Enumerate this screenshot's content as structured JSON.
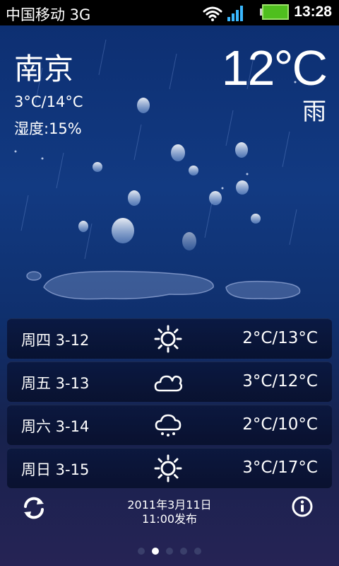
{
  "status_bar": {
    "carrier": "中国移动 3G",
    "time": "13:28",
    "icons": [
      "wifi-icon",
      "signal-icon",
      "battery-icon"
    ]
  },
  "weather": {
    "city": "南京",
    "temp_range": "3°C/14°C",
    "humidity": "湿度:15%",
    "current_temp": "12°C",
    "condition": "雨"
  },
  "forecast": [
    {
      "day": "周四 3-12",
      "icon": "sun-icon",
      "temp": "2°C/13°C"
    },
    {
      "day": "周五 3-13",
      "icon": "cloud-icon",
      "temp": "3°C/12°C"
    },
    {
      "day": "周六 3-14",
      "icon": "rain-cloud-icon",
      "temp": "2°C/10°C"
    },
    {
      "day": "周日 3-15",
      "icon": "sun-icon",
      "temp": "3°C/17°C"
    }
  ],
  "footer": {
    "publish_date": "2011年3月11日",
    "publish_time": "11:00发布"
  },
  "pager": {
    "count": 5,
    "active": 2
  }
}
